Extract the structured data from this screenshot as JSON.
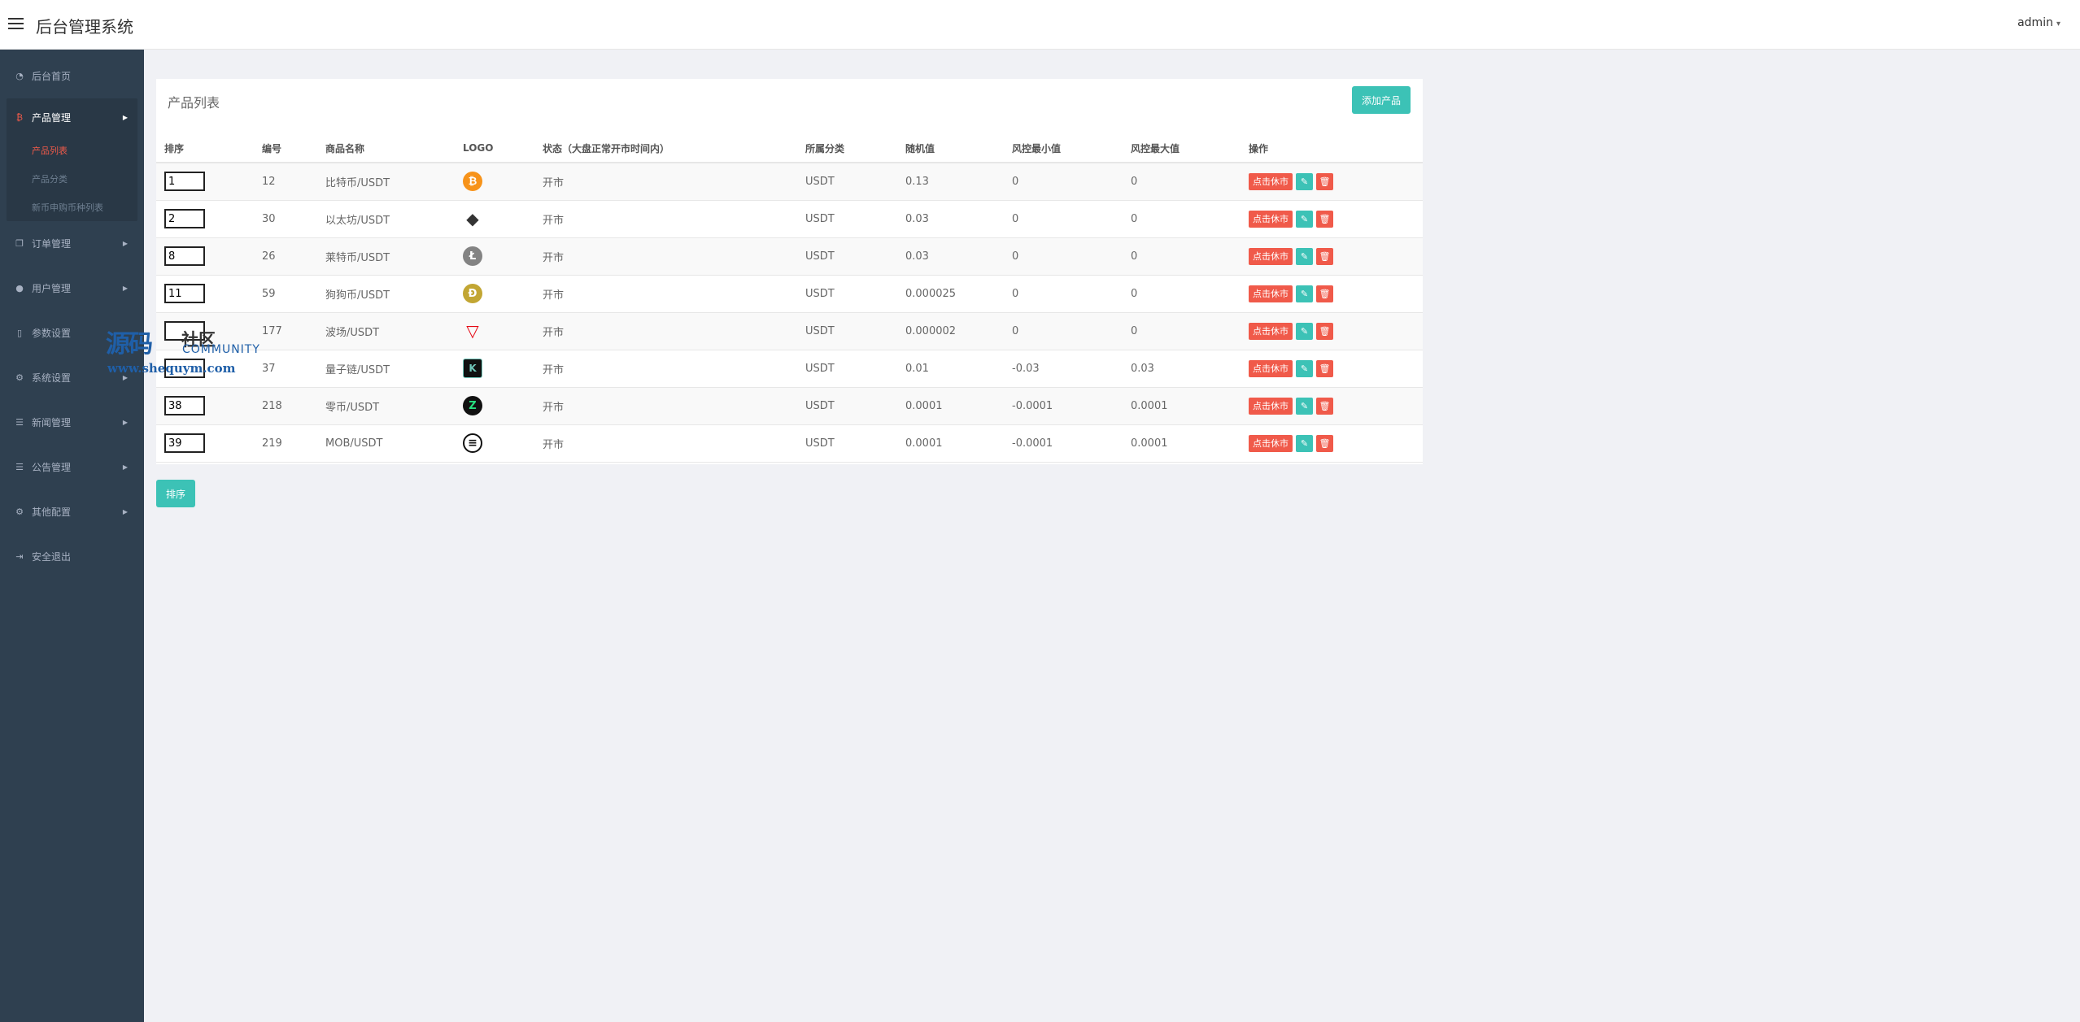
{
  "header": {
    "title": "后台管理系统",
    "user": "admin"
  },
  "sidebar": {
    "items": [
      {
        "label": "后台首页",
        "icon": "dashboard-icon"
      },
      {
        "label": "产品管理",
        "icon": "bitcoin-icon"
      },
      {
        "label": "订单管理",
        "icon": "copy-icon"
      },
      {
        "label": "用户管理",
        "icon": "user-icon"
      },
      {
        "label": "参数设置",
        "icon": "file-icon"
      },
      {
        "label": "系统设置",
        "icon": "gears-icon"
      },
      {
        "label": "新闻管理",
        "icon": "list-icon"
      },
      {
        "label": "公告管理",
        "icon": "list-icon"
      },
      {
        "label": "其他配置",
        "icon": "gear-icon"
      },
      {
        "label": "安全退出",
        "icon": "sign-out-icon"
      }
    ],
    "sub_items": [
      "产品列表",
      "产品分类",
      "新币申购币种列表"
    ]
  },
  "watermark": {
    "big": "源码",
    "small": "社区",
    "community": "COMMUNITY",
    "url": "www.shequym.com"
  },
  "panel": {
    "title": "产品列表",
    "add_button": "添加产品",
    "columns": [
      "排序",
      "编号",
      "商品名称",
      "LOGO",
      "状态（大盘正常开市时间内）",
      "所属分类",
      "随机值",
      "风控最小值",
      "风控最大值",
      "操作"
    ],
    "rows": [
      {
        "sort": "1",
        "id": "12",
        "name": "比特币/USDT",
        "logo": "bitcoin-logo-icon",
        "glyph": "₿",
        "status": "开市",
        "category": "USDT",
        "random": "0.13",
        "risk_min": "0",
        "risk_max": "0"
      },
      {
        "sort": "2",
        "id": "30",
        "name": "以太坊/USDT",
        "logo": "ethereum-logo-icon",
        "glyph": "◆",
        "status": "开市",
        "category": "USDT",
        "random": "0.03",
        "risk_min": "0",
        "risk_max": "0"
      },
      {
        "sort": "8",
        "id": "26",
        "name": "莱特币/USDT",
        "logo": "litecoin-logo-icon",
        "glyph": "Ł",
        "status": "开市",
        "category": "USDT",
        "random": "0.03",
        "risk_min": "0",
        "risk_max": "0"
      },
      {
        "sort": "11",
        "id": "59",
        "name": "狗狗币/USDT",
        "logo": "dogecoin-logo-icon",
        "glyph": "Ð",
        "status": "开市",
        "category": "USDT",
        "random": "0.000025",
        "risk_min": "0",
        "risk_max": "0"
      },
      {
        "sort": "",
        "id": "177",
        "name": "波场/USDT",
        "logo": "tron-logo-icon",
        "glyph": "▽",
        "status": "开市",
        "category": "USDT",
        "random": "0.000002",
        "risk_min": "0",
        "risk_max": "0"
      },
      {
        "sort": "",
        "id": "37",
        "name": "量子链/USDT",
        "logo": "kaspa-logo-icon",
        "glyph": "K",
        "status": "开市",
        "category": "USDT",
        "random": "0.01",
        "risk_min": "-0.03",
        "risk_max": "0.03"
      },
      {
        "sort": "38",
        "id": "218",
        "name": "零币/USDT",
        "logo": "zcash-logo-icon",
        "glyph": "Z",
        "status": "开市",
        "category": "USDT",
        "random": "0.0001",
        "risk_min": "-0.0001",
        "risk_max": "0.0001"
      },
      {
        "sort": "39",
        "id": "219",
        "name": "MOB/USDT",
        "logo": "mobilecoin-logo-icon",
        "glyph": "≡",
        "status": "开市",
        "category": "USDT",
        "random": "0.0001",
        "risk_min": "-0.0001",
        "risk_max": "0.0001"
      }
    ],
    "rest_button": "点击休市",
    "edit_icon": "pencil-icon",
    "delete_icon": "trash-icon"
  },
  "sort_button": "排序"
}
